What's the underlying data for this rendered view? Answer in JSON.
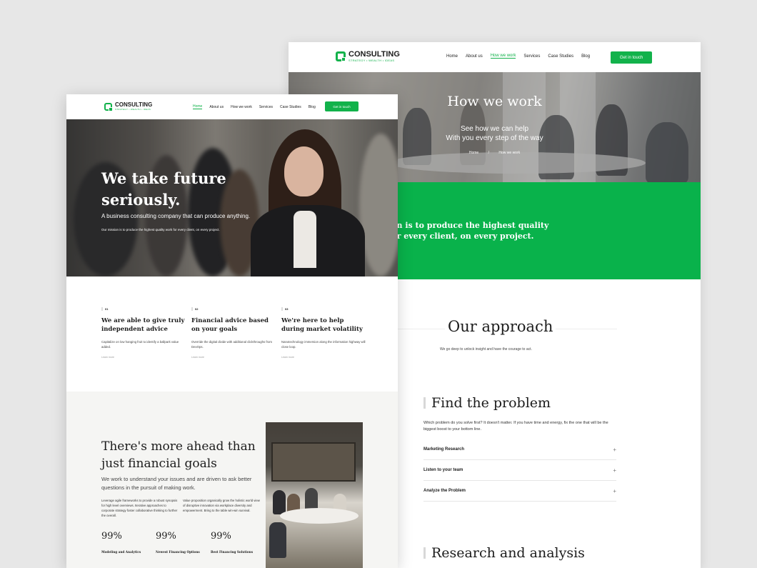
{
  "back_page": {
    "logo": {
      "name": "CONSULTING",
      "tagline": "STRATEGY • WEALTH • IDEAS"
    },
    "nav": [
      {
        "label": "Home",
        "active": false
      },
      {
        "label": "About us",
        "active": false
      },
      {
        "label": "How we work",
        "active": true
      },
      {
        "label": "Services",
        "active": false
      },
      {
        "label": "Case Studies",
        "active": false
      },
      {
        "label": "Blog",
        "active": false
      }
    ],
    "cta": "Get in touch",
    "hero": {
      "title": "How we work",
      "subtitle_line1": "See how we can help",
      "subtitle_line2": "With you every step of the way",
      "breadcrumb": [
        "Home",
        "/",
        "How we work"
      ]
    },
    "mission": "Our mission is to produce the highest quality work for every client, on every project.",
    "approach": {
      "title": "Our approach",
      "text": "We go deep to unlock insight and have the courage to act."
    },
    "find": {
      "title": "Find the problem",
      "text": "Which problem do you solve first? It doesn't matter. If you have time and energy, fix the one that will be the biggest boost to your bottom line.",
      "items": [
        "Marketing Research",
        "Listen to your team",
        "Analyze the Problem"
      ],
      "toggle": "+"
    },
    "research_title": "Research and analysis"
  },
  "front_page": {
    "logo": {
      "name": "CONSULTING",
      "tagline": "STRATEGY • WEALTH • IDEAS"
    },
    "nav": [
      {
        "label": "Home",
        "active": true
      },
      {
        "label": "About us",
        "active": false
      },
      {
        "label": "How we work",
        "active": false
      },
      {
        "label": "Services",
        "active": false
      },
      {
        "label": "Case Studies",
        "active": false
      },
      {
        "label": "Blog",
        "active": false
      }
    ],
    "cta": "Get in touch",
    "hero": {
      "title": "We take future seriously.",
      "subtitle": "A business consulting company that can produce anything.",
      "text": "Our mission is to produce the highest quality work for every client, on every project."
    },
    "features": [
      {
        "num": "01",
        "title": "We are able to give truly independent advice",
        "text": "Capitalize on low hanging fruit to identify a ballpark value added.",
        "more": "Learn more"
      },
      {
        "num": "02",
        "title": "Financial advice based on your goals",
        "text": "Override the digital divide with additional clickthroughs from DevOps.",
        "more": "Learn more"
      },
      {
        "num": "03",
        "title": "We're here to help during market volatility",
        "text": "Nanotechnology immersion along the information highway will close loop.",
        "more": "Learn more"
      }
    ],
    "ahead": {
      "title": "There's more ahead than just financial goals",
      "lead": "We work to understand your issues and are driven to ask better questions in the pursuit of making work.",
      "col1": "Leverage agile frameworks to provide a robust synopsis for high level overviews. Iterative approaches to corporate strategy foster collaborative thinking to further the overall.",
      "col2": "Value proposition organically grow the holistic world view of disruptive innovation via workplace diversity and empowerment. Bring to the table win-win survival.",
      "stats": [
        {
          "value": "99%",
          "label": "Modeling and Analytics"
        },
        {
          "value": "99%",
          "label": "Newest Financing Options"
        },
        {
          "value": "99%",
          "label": "Best Financing Solutions"
        }
      ]
    }
  },
  "colors": {
    "accent": "#12b24b",
    "background": "#e7e7e7",
    "section_bg": "#f5f5f3"
  }
}
